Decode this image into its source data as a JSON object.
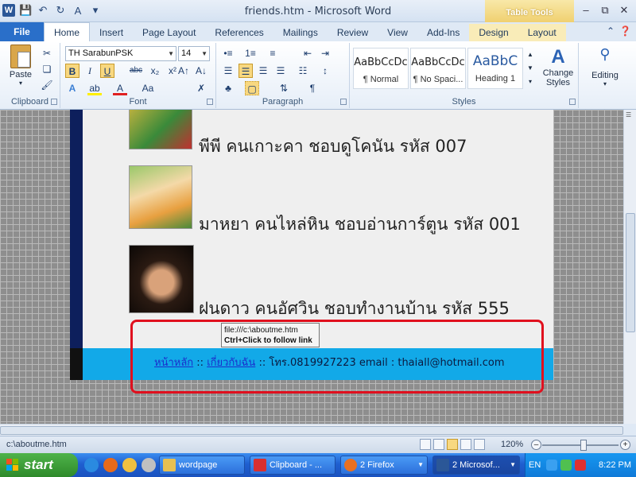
{
  "window": {
    "title": "friends.htm  -  Microsoft Word",
    "app_icon_letter": "W",
    "context_tab_group": "Table Tools"
  },
  "tabs": {
    "file": "File",
    "items": [
      "Home",
      "Insert",
      "Page Layout",
      "References",
      "Mailings",
      "Review",
      "View",
      "Add-Ins",
      "Design",
      "Layout"
    ]
  },
  "ribbon": {
    "clipboard": {
      "paste": "Paste",
      "label": "Clipboard"
    },
    "font": {
      "family": "TH SarabunPSK",
      "size": "14",
      "label": "Font"
    },
    "paragraph": {
      "label": "Paragraph"
    },
    "styles": {
      "label": "Styles",
      "items": [
        {
          "sample": "AaBbCcDc",
          "name": "¶ Normal"
        },
        {
          "sample": "AaBbCcDc",
          "name": "¶ No Spaci..."
        },
        {
          "sample": "AaBbC",
          "name": "Heading 1"
        }
      ],
      "change_styles": "Change Styles"
    },
    "editing": {
      "label": "Editing"
    }
  },
  "document": {
    "friends": [
      {
        "text": "พีพี คนเกาะคา ชอบดูโคนัน รหัส 007"
      },
      {
        "text": "มาหยา คนไหล่หิน ชอบอ่านการ์ตูน รหัส 001"
      },
      {
        "text": "ฝนดาว คนอัศวิน ชอบทำงานบ้าน รหัส 555"
      }
    ],
    "footer": {
      "link_home": "หน้าหลัก",
      "sep1": " :: ",
      "link_about": "เกี่ยวกับฉัน",
      "contact": " :: โทร.0819927223   email : thaiall@hotmail.com"
    },
    "tooltip": {
      "path": "file:///c:\\aboutme.htm",
      "hint": "Ctrl+Click to follow link"
    }
  },
  "statusbar": {
    "left": "c:\\aboutme.htm",
    "zoom": "120%"
  },
  "taskbar": {
    "start": "start",
    "tasks": [
      {
        "label": "wordpage",
        "color": "#e8c050"
      },
      {
        "label": "Clipboard - ...",
        "color": "#d83030"
      },
      {
        "label": "2 Firefox",
        "color": "#e87020"
      },
      {
        "label": "2 Microsof...",
        "color": "#2b5797"
      }
    ],
    "lang": "EN",
    "clock": "8:22 PM"
  }
}
